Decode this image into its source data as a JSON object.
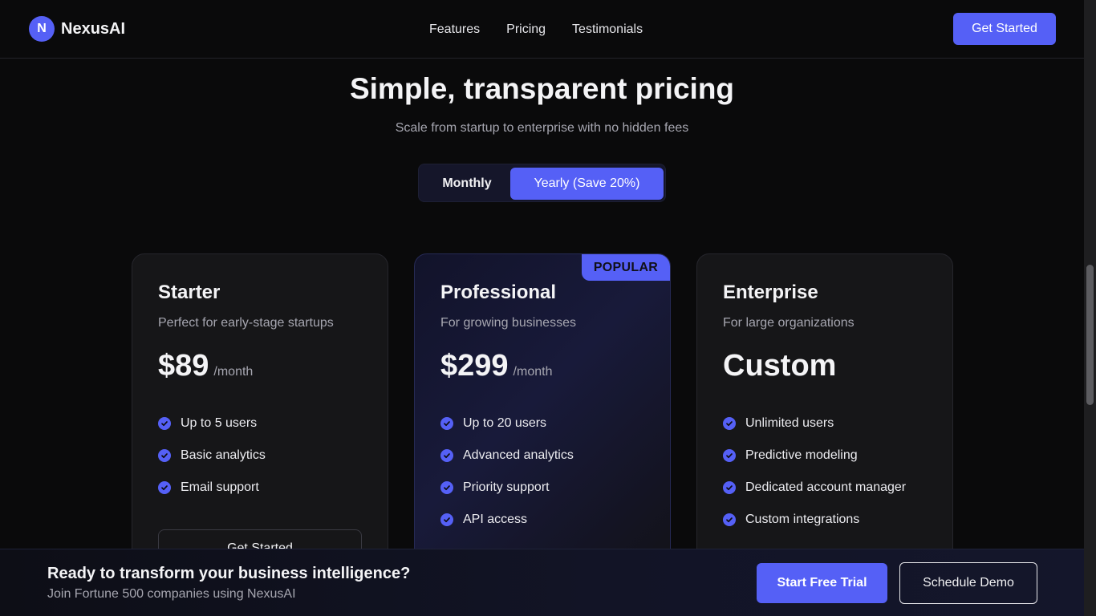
{
  "brand": {
    "logo_letter": "N",
    "name": "NexusAI"
  },
  "nav": {
    "links": [
      "Features",
      "Pricing",
      "Testimonials"
    ],
    "cta": "Get Started"
  },
  "hero": {
    "title": "Simple, transparent pricing",
    "subtitle": "Scale from startup to enterprise with no hidden fees"
  },
  "billing_toggle": {
    "monthly": "Monthly",
    "yearly": "Yearly (Save 20%)",
    "selected": "yearly"
  },
  "plans": [
    {
      "name": "Starter",
      "description": "Perfect for early-stage startups",
      "price": "$89",
      "period": "/month",
      "features": [
        "Up to 5 users",
        "Basic analytics",
        "Email support"
      ],
      "button": "Get Started"
    },
    {
      "name": "Professional",
      "badge": "POPULAR",
      "description": "For growing businesses",
      "price": "$299",
      "period": "/month",
      "features": [
        "Up to 20 users",
        "Advanced analytics",
        "Priority support",
        "API access"
      ]
    },
    {
      "name": "Enterprise",
      "description": "For large organizations",
      "price": "Custom",
      "features": [
        "Unlimited users",
        "Predictive modeling",
        "Dedicated account manager",
        "Custom integrations"
      ]
    }
  ],
  "cta_bar": {
    "heading": "Ready to transform your business intelligence?",
    "subtext": "Join Fortune 500 companies using NexusAI",
    "primary": "Start Free Trial",
    "secondary": "Schedule Demo"
  },
  "colors": {
    "accent": "#5560f6",
    "background": "#0a0a0b",
    "card": "#161618"
  }
}
